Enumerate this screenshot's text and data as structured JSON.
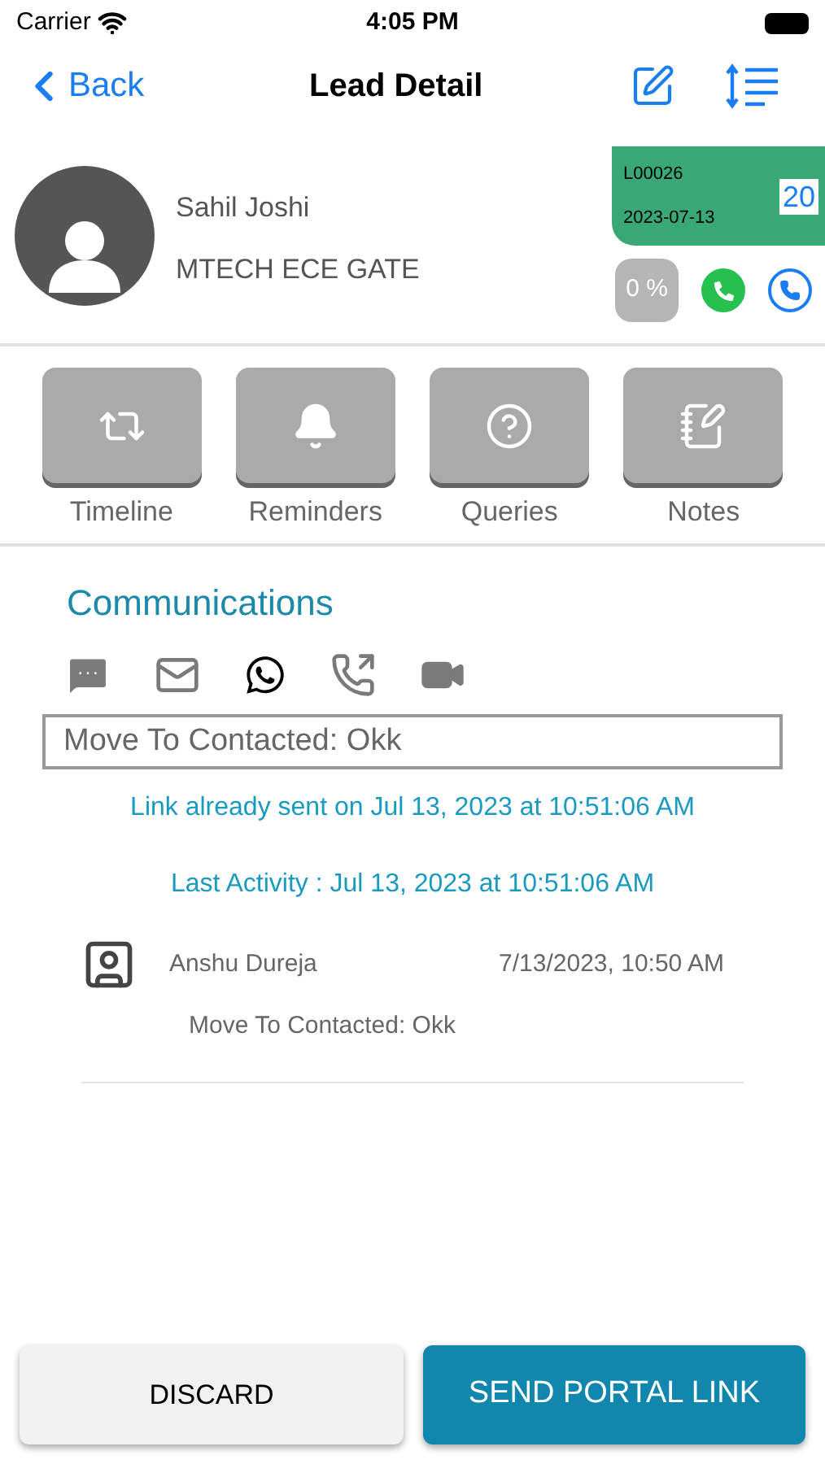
{
  "status_bar": {
    "carrier": "Carrier",
    "time": "4:05 PM"
  },
  "nav": {
    "back": "Back",
    "title": "Lead Detail"
  },
  "lead": {
    "name": "Sahil Joshi",
    "course": "MTECH ECE GATE",
    "code": "L00026",
    "date": "2023-07-13",
    "count": "20",
    "progress": "0 %"
  },
  "actions": [
    {
      "kind": "timeline",
      "label": "Timeline"
    },
    {
      "kind": "reminders",
      "label": "Reminders"
    },
    {
      "kind": "queries",
      "label": "Queries"
    },
    {
      "kind": "notes",
      "label": "Notes"
    }
  ],
  "communications": {
    "title": "Communications",
    "channels": [
      {
        "kind": "sms",
        "selected": false
      },
      {
        "kind": "email",
        "selected": false
      },
      {
        "kind": "whatsapp",
        "selected": true
      },
      {
        "kind": "call",
        "selected": false
      },
      {
        "kind": "video",
        "selected": false
      }
    ],
    "message": "Move To Contacted: Okk",
    "link_status": "Link already sent on Jul 13, 2023 at 10:51:06 AM",
    "last_activity": "Last Activity : Jul 13, 2023 at 10:51:06 AM",
    "entries": [
      {
        "author": "Anshu Dureja",
        "time": "7/13/2023, 10:50 AM",
        "text": "Move To Contacted: Okk"
      }
    ]
  },
  "buttons": {
    "discard": "DISCARD",
    "send": "SEND PORTAL LINK"
  }
}
